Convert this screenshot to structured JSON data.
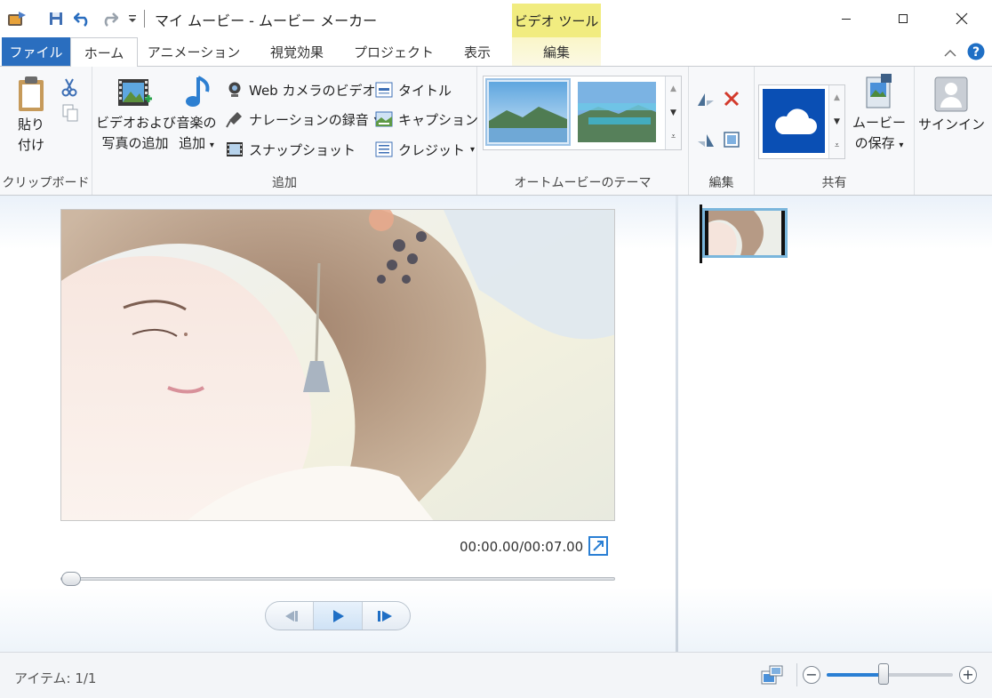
{
  "window": {
    "title": "マイ ムービー - ムービー メーカー",
    "context_tab_header": "ビデオ ツール"
  },
  "tabs": [
    {
      "label": "ファイル"
    },
    {
      "label": "ホーム"
    },
    {
      "label": "アニメーション"
    },
    {
      "label": "視覚効果"
    },
    {
      "label": "プロジェクト"
    },
    {
      "label": "表示"
    },
    {
      "label": "編集"
    }
  ],
  "ribbon": {
    "clipboard": {
      "label": "クリップボード",
      "paste_line1": "貼り",
      "paste_line2": "付け"
    },
    "add": {
      "label": "追加",
      "add_video_line1": "ビデオおよび",
      "add_video_line2": "写真の追加",
      "add_music_line1": "音楽の",
      "add_music_line2": "追加",
      "webcam": "Web カメラのビデオ",
      "narration": "ナレーションの録音",
      "snapshot": "スナップショット",
      "title": "タイトル",
      "caption": "キャプション",
      "credits": "クレジット"
    },
    "automovie": {
      "label": "オートムービーのテーマ"
    },
    "edit": {
      "label": "編集"
    },
    "share": {
      "label": "共有",
      "save_line1": "ムービー",
      "save_line2": "の保存"
    },
    "signin": {
      "label": "サインイン"
    }
  },
  "preview": {
    "timecode": "00:00.00/00:07.00",
    "progress": 0
  },
  "status": {
    "items": "アイテム: 1/1",
    "zoom_level": 0.45
  },
  "colors": {
    "file_tab": "#2a6ebf",
    "context_tab": "#f1ec80",
    "accent": "#2a7fd4"
  }
}
